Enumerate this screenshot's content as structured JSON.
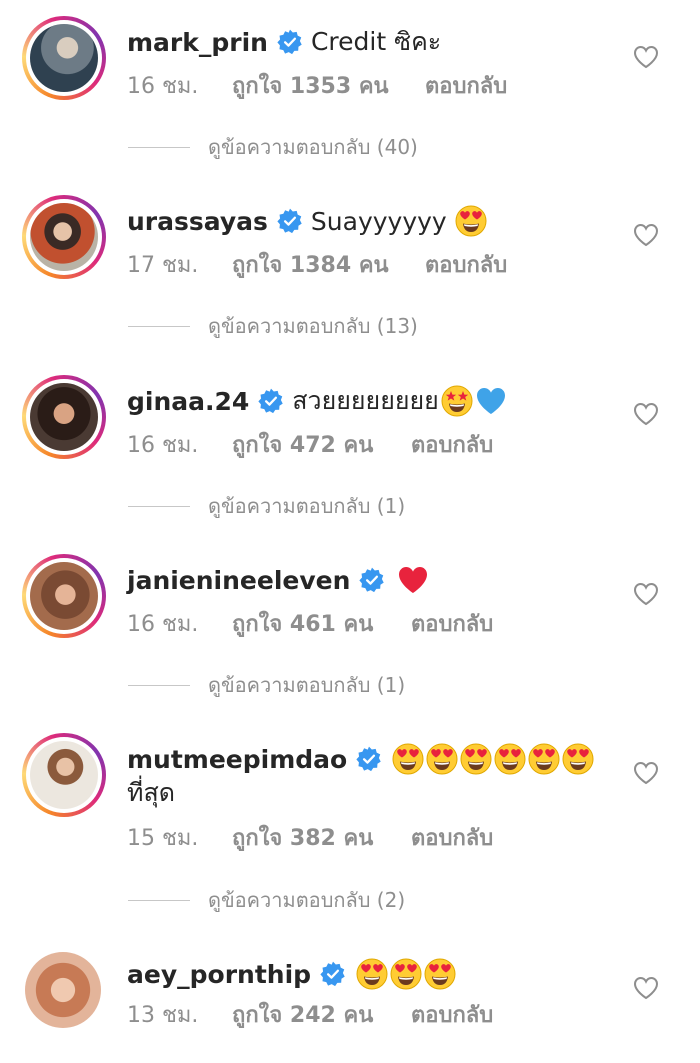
{
  "comments": [
    {
      "username": "mark_prin",
      "text": "Credit ซิคะ",
      "emojis": [],
      "time": "16 ชม.",
      "likes": "ถูกใจ 1353 คน",
      "reply": "ตอบกลับ",
      "view_replies": "ดูข้อความตอบกลับ (40)",
      "verified_icon": "verified-badge-icon",
      "like_icon": "heart-outline-icon"
    },
    {
      "username": "urassayas",
      "text": "Suayyyyyy",
      "emojis": [
        "heart-eyes"
      ],
      "time": "17 ชม.",
      "likes": "ถูกใจ 1384 คน",
      "reply": "ตอบกลับ",
      "view_replies": "ดูข้อความตอบกลับ (13)",
      "verified_icon": "verified-badge-icon",
      "like_icon": "heart-outline-icon"
    },
    {
      "username": "ginaa.24",
      "text": "สวยยยยยยยย",
      "emojis": [
        "star-struck",
        "blue-heart"
      ],
      "time": "16 ชม.",
      "likes": "ถูกใจ 472 คน",
      "reply": "ตอบกลับ",
      "view_replies": "ดูข้อความตอบกลับ (1)",
      "verified_icon": "verified-badge-icon",
      "like_icon": "heart-outline-icon"
    },
    {
      "username": "janienineeleven",
      "text": "",
      "emojis": [
        "red-heart"
      ],
      "time": "16 ชม.",
      "likes": "ถูกใจ 461 คน",
      "reply": "ตอบกลับ",
      "view_replies": "ดูข้อความตอบกลับ (1)",
      "verified_icon": "verified-badge-icon",
      "like_icon": "heart-outline-icon"
    },
    {
      "username": "mutmeepimdao",
      "text": "",
      "text_line2": "ที่สุด",
      "emojis": [
        "heart-eyes",
        "heart-eyes",
        "heart-eyes",
        "heart-eyes",
        "heart-eyes",
        "heart-eyes"
      ],
      "time": "15 ชม.",
      "likes": "ถูกใจ 382 คน",
      "reply": "ตอบกลับ",
      "view_replies": "ดูข้อความตอบกลับ (2)",
      "verified_icon": "verified-badge-icon",
      "like_icon": "heart-outline-icon"
    },
    {
      "username": "aey_pornthip",
      "text": "",
      "emojis": [
        "heart-eyes",
        "heart-eyes",
        "heart-eyes"
      ],
      "time": "13 ชม.",
      "likes": "ถูกใจ 242 คน",
      "reply": "ตอบกลับ",
      "verified_icon": "verified-badge-icon",
      "like_icon": "heart-outline-icon"
    }
  ],
  "colors": {
    "username": "#262626",
    "meta": "#8e8e8e",
    "verified": "#3897f0",
    "story_ring_start": "#f58529",
    "story_ring_end": "#8134af"
  }
}
